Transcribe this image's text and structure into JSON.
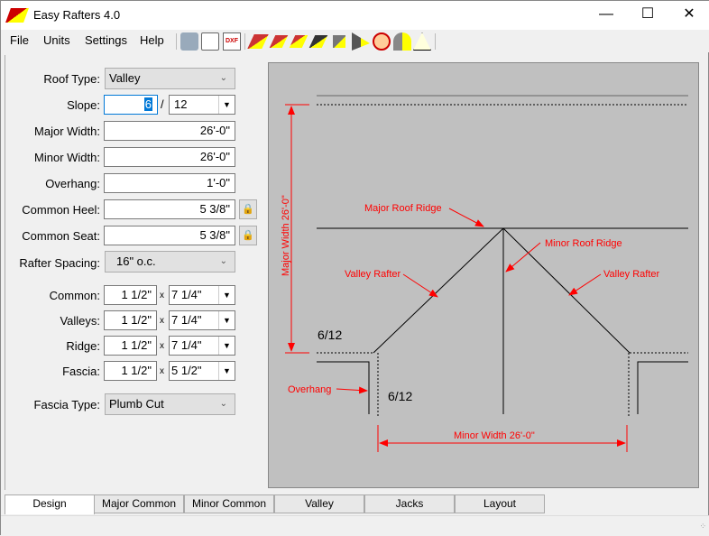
{
  "window": {
    "title": "Easy Rafters 4.0",
    "min": "—",
    "max": "☐",
    "close": "✕"
  },
  "menu": [
    "File",
    "Units",
    "Settings",
    "Help"
  ],
  "toolbar": {
    "icons": [
      "print-icon",
      "print-preview-icon",
      "dxf-export-icon",
      "common-rafter-icon",
      "hip-rafter-icon",
      "valley-rafter-icon",
      "jack-rafter-icon",
      "gable-icon",
      "shed-icon",
      "octagon-icon",
      "dormer-icon",
      "gazebo-icon"
    ],
    "dxf_label": "DXF"
  },
  "form": {
    "roof_type": {
      "label": "Roof Type:",
      "value": "Valley"
    },
    "slope": {
      "label": "Slope:",
      "rise": "6",
      "sep": "/",
      "run": "12"
    },
    "major_width": {
      "label": "Major Width:",
      "value": "26'-0\""
    },
    "minor_width": {
      "label": "Minor Width:",
      "value": "26'-0\""
    },
    "overhang": {
      "label": "Overhang:",
      "value": "1'-0\""
    },
    "common_heel": {
      "label": "Common Heel:",
      "value": "5 3/8\""
    },
    "common_seat": {
      "label": "Common Seat:",
      "value": "5 3/8\""
    },
    "rafter_spacing": {
      "label": "Rafter Spacing:",
      "value": "16\" o.c."
    },
    "lumber": [
      {
        "label": "Common:",
        "thick": "1 1/2\"",
        "depth": "7 1/4\""
      },
      {
        "label": "Valleys:",
        "thick": "1 1/2\"",
        "depth": "7 1/4\""
      },
      {
        "label": "Ridge:",
        "thick": "1 1/2\"",
        "depth": "7 1/4\""
      },
      {
        "label": "Fascia:",
        "thick": "1 1/2\"",
        "depth": "5 1/2\""
      }
    ],
    "times": "x",
    "fascia_type": {
      "label": "Fascia Type:",
      "value": "Plumb Cut"
    }
  },
  "diagram": {
    "major_width": "Major Width  26'-0\"",
    "major_ridge": "Major Roof Ridge",
    "minor_ridge": "Minor Roof Ridge",
    "valley_left": "Valley Rafter",
    "valley_right": "Valley Rafter",
    "slope1": "6/12",
    "slope2": "6/12",
    "overhang": "Overhang",
    "minor_width": "Minor Width  26'-0\"",
    "colors": {
      "dimension": "#ff0000",
      "line": "#000000",
      "background": "#c0c0c0"
    }
  },
  "tabs": [
    "Design",
    "Major Common",
    "Minor Common",
    "Valley",
    "Jacks",
    "Layout"
  ],
  "active_tab": "Design"
}
